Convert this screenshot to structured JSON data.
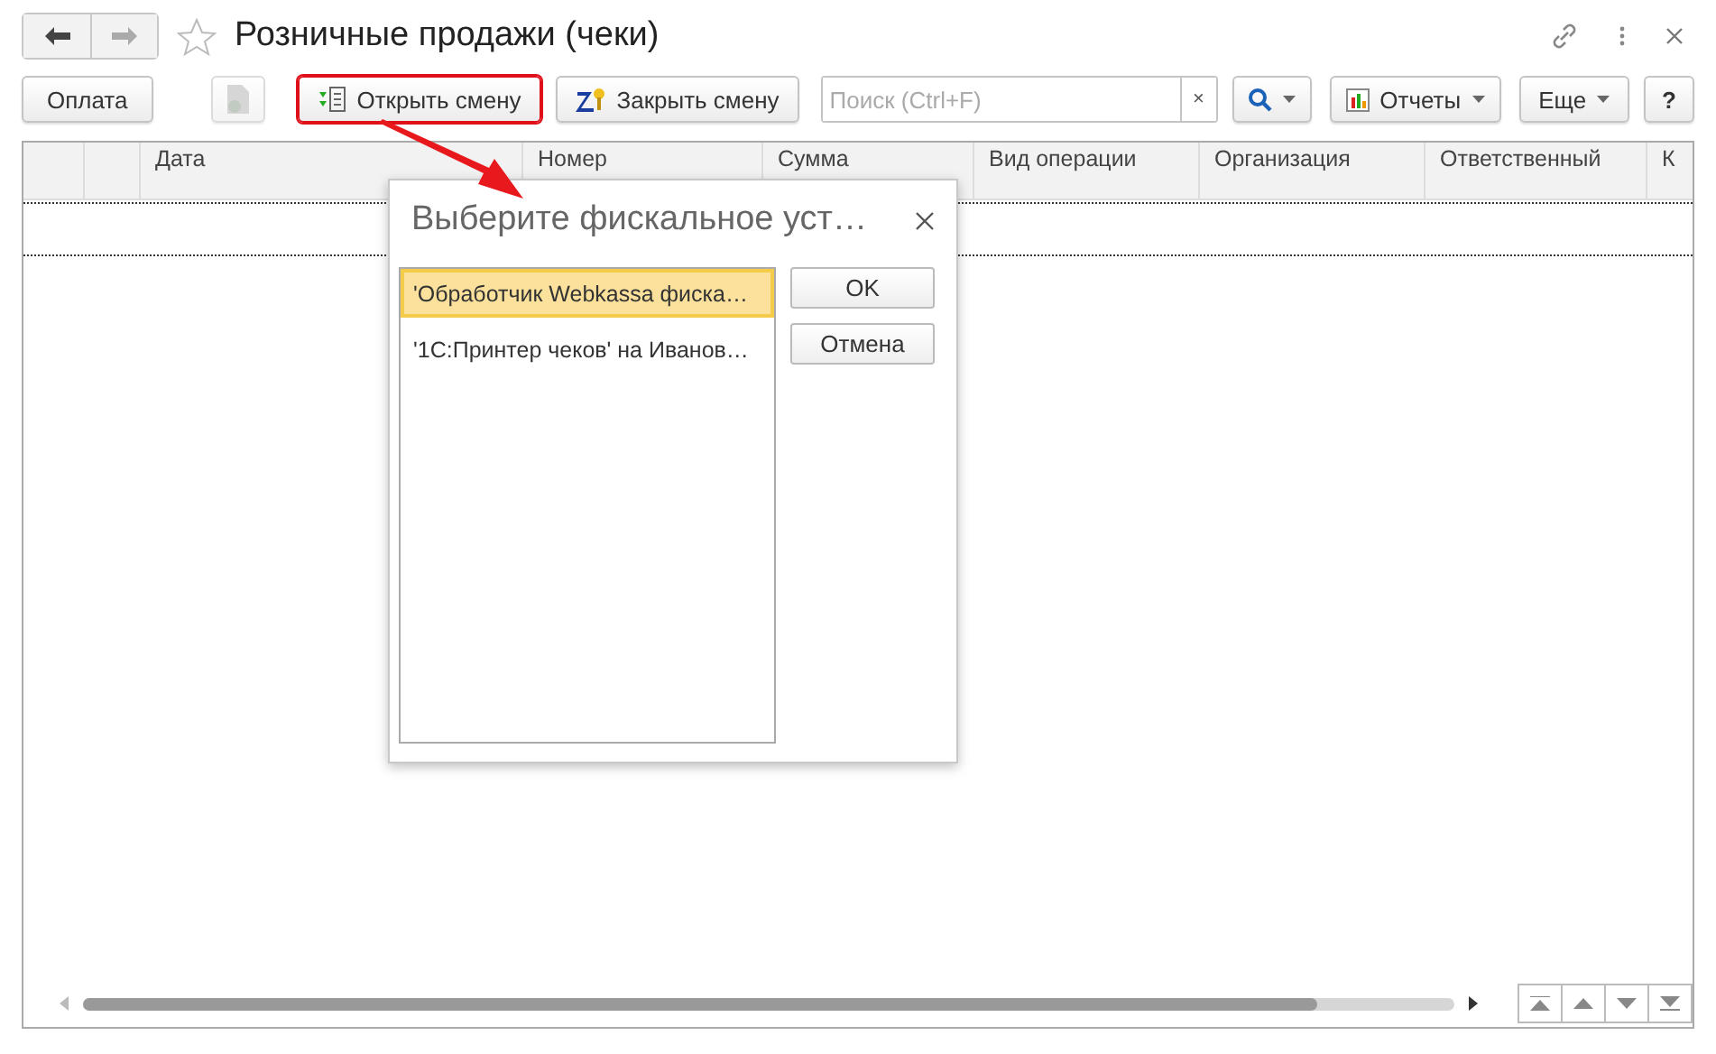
{
  "window": {
    "title": "Розничные продажи (чеки)"
  },
  "toolbar": {
    "payment": "Оплата",
    "open_shift": {
      "label": "Открыть смену",
      "highlighted": true
    },
    "close_shift": "Закрыть смену",
    "search": {
      "placeholder": "Поиск (Ctrl+F)",
      "clear": "×"
    },
    "reports": "Отчеты",
    "more": "Еще",
    "help": "?"
  },
  "table": {
    "columns": [
      "",
      "",
      "Дата",
      "Номер",
      "Сумма",
      "Вид операции",
      "Организация",
      "Ответственный",
      "К"
    ]
  },
  "dialog": {
    "title": "Выберите фискальное уст…",
    "items": [
      {
        "label": "'Обработчик Webkassa фиска…",
        "selected": true
      },
      {
        "label": "'1С:Принтер чеков' на Иванов…",
        "selected": false
      }
    ],
    "buttons": [
      "OK",
      "Отмена"
    ]
  }
}
